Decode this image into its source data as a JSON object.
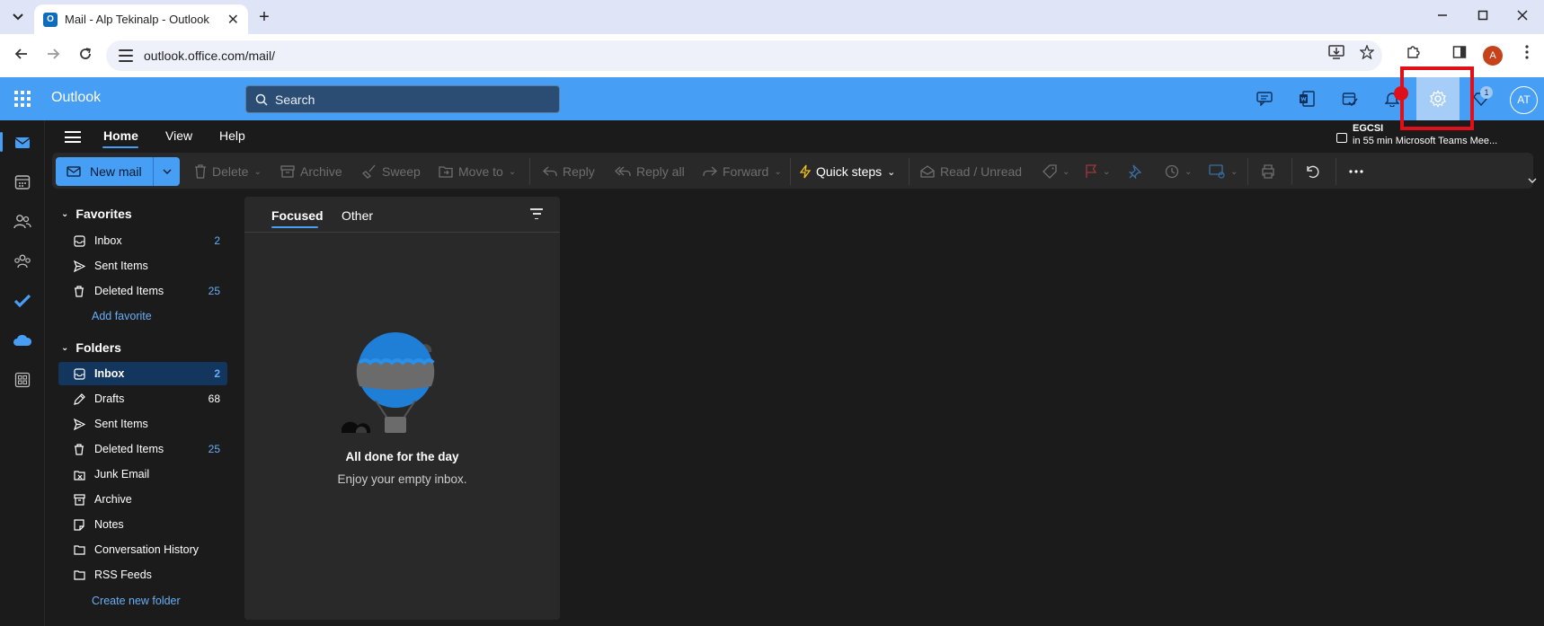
{
  "browser": {
    "tab_title": "Mail - Alp Tekinalp - Outlook",
    "tab_close": "✕",
    "new_tab": "+",
    "url": "outlook.office.com/mail/",
    "profile_initial": "A"
  },
  "header": {
    "app_name": "Outlook",
    "search_placeholder": "Search",
    "notification_badge": "1",
    "avatar_initials": "AT",
    "accent_color": "#479ef5",
    "highlight_color": "#e0101b"
  },
  "ribbon_tabs": [
    "Home",
    "View",
    "Help"
  ],
  "reminder": {
    "title": "EGCSI",
    "detail": "in 55 min Microsoft Teams Mee..."
  },
  "toolbar": {
    "new_mail": "New mail",
    "delete": "Delete",
    "archive": "Archive",
    "sweep": "Sweep",
    "move_to": "Move to",
    "reply": "Reply",
    "reply_all": "Reply all",
    "forward": "Forward",
    "quick_steps": "Quick steps",
    "read_unread": "Read / Unread"
  },
  "favorites": {
    "title": "Favorites",
    "items": [
      {
        "label": "Inbox",
        "count": "2"
      },
      {
        "label": "Sent Items",
        "count": ""
      },
      {
        "label": "Deleted Items",
        "count": "25"
      }
    ],
    "add_link": "Add favorite"
  },
  "folders": {
    "title": "Folders",
    "items": [
      {
        "label": "Inbox",
        "count": "2"
      },
      {
        "label": "Drafts",
        "count": "68"
      },
      {
        "label": "Sent Items",
        "count": ""
      },
      {
        "label": "Deleted Items",
        "count": "25"
      },
      {
        "label": "Junk Email",
        "count": ""
      },
      {
        "label": "Archive",
        "count": ""
      },
      {
        "label": "Notes",
        "count": ""
      },
      {
        "label": "Conversation History",
        "count": ""
      },
      {
        "label": "RSS Feeds",
        "count": ""
      }
    ],
    "create_link": "Create new folder"
  },
  "message_list": {
    "tabs": [
      "Focused",
      "Other"
    ],
    "empty_title": "All done for the day",
    "empty_subtitle": "Enjoy your empty inbox."
  }
}
